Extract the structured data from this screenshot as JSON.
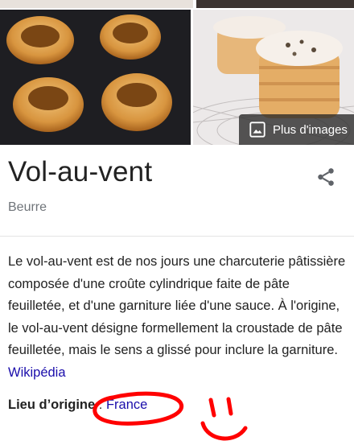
{
  "images": {
    "more_images_label": "Plus d'images",
    "left_alt": "vol-au-vent on black slate",
    "right_alt": "vol-au-vent on wire rack"
  },
  "entity": {
    "title": "Vol-au-vent",
    "subtitle": "Beurre"
  },
  "description": {
    "text": "Le vol-au-vent est de nos jours une charcuterie pâtissière composée d'une croûte cylindrique faite de pâte feuilletée, et d'une garniture liée d'une sauce. À l'origine, le vol-au-vent désigne formellement la croustade de pâte feuilletée, mais le sens a glissé pour inclure la garniture. ",
    "source_link": "Wikipédia"
  },
  "origin": {
    "label": "Lieu d’origine",
    "separator": " : ",
    "value": "France"
  },
  "colors": {
    "link": "#1a0dab",
    "annotation": "#ff0000"
  },
  "icons": [
    "image-icon",
    "share-icon"
  ]
}
